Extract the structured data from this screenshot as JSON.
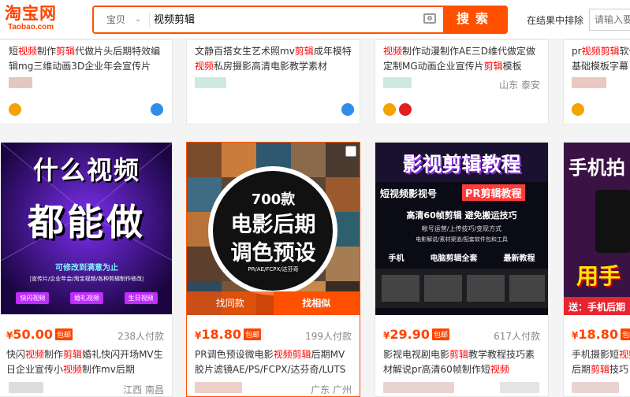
{
  "header": {
    "logo_cn": "淘宝网",
    "logo_en": "Taobao.com",
    "scope": "宝贝",
    "query": "视频剪辑",
    "search_button": "搜索",
    "exclude_label": "在结果中排除",
    "exclude_placeholder": "请输入要"
  },
  "top_row": [
    {
      "l1a": "短",
      "l1k": "视频",
      "l1b": "制作",
      "l1k2": "剪辑",
      "l1c": "代做片头后期特效编",
      "l2": "辑mg三维动画3D企业年会宣传片",
      "loc": ""
    },
    {
      "l1a": "文静百搭女生艺术照mv",
      "l1k": "剪辑",
      "l1b": "成年模特",
      "l2k": "视频",
      "l2": "私房摄影高清电影教学素材",
      "loc": ""
    },
    {
      "l1k": "视频",
      "l1b": "制作动漫制作AE三D维代做定做",
      "l2a": "定制MG动画企业宣传片",
      "l2k": "剪辑",
      "l2b": "模板",
      "loc": "山东 泰安"
    },
    {
      "l1a": "pr",
      "l1k": "视频剪辑",
      "l1b": "软件",
      "l2": "基础模板字幕",
      "loc": ""
    }
  ],
  "products": [
    {
      "banner_l1": "什么视频",
      "banner_l2": "都能做",
      "banner_sub": "可修改到满意为止",
      "banner_tags": "|宣传片/企业年会/淘宝视频/各种剪辑制作修改|",
      "banner_pill1": "快闪视频",
      "banner_pill2": "婚礼视频",
      "banner_pill3": "生日视频",
      "price": "50.00",
      "badge": "包邮",
      "sold": "238人付款",
      "t1a": "快闪",
      "t1k": "视频",
      "t1b": "制作",
      "t1k2": "剪辑",
      "t1c": "婚礼快闪开场MV生",
      "t2a": "日企业宣传小",
      "t2k": "视频",
      "t2b": "制作mv后期",
      "loc": "江西 南昌"
    },
    {
      "circle_num": "700款",
      "circle_l1": "电影后期",
      "circle_l2": "调色预设",
      "circle_small": "PR/AE/FCPX/达芬奇",
      "btn_same": "找同款",
      "btn_similar": "找相似",
      "price": "18.80",
      "badge": "包邮",
      "sold": "199人付款",
      "t1a": "PR调色预设微电影",
      "t1k": "视频剪辑",
      "t1b": "后期MV",
      "t2": "胶片滤镜AE/PS/FCPX/达芬奇/LUTS",
      "loc": "广东 广州"
    },
    {
      "banner_title": "影视剪辑教程",
      "banner_l2a": "短视频影视号",
      "banner_l2b": "PR剪辑教程",
      "banner_l3": "高清60帧剪辑  避免搬运技巧",
      "banner_l4": "帐号运营/上传技巧/变现方式",
      "banner_l5": "电影解说/素材渠道/配套软件包和工具",
      "banner_l6a": "手机",
      "banner_l6b": "电脑剪辑全套",
      "banner_l6c": "最新教程",
      "price": "29.90",
      "badge": "包邮",
      "sold": "617人付款",
      "t1a": "影视电视剧电影",
      "t1k": "剪辑",
      "t1b": "教学教程技巧素",
      "t2a": "材解说pr高清60帧制作短",
      "t2k": "视频",
      "loc": ""
    },
    {
      "banner_title": "手机拍",
      "banner_mid": "用手",
      "banner_send": "送：手机后期",
      "price": "18.80",
      "badge": "包邮",
      "t1": "手机摄影短",
      "t1k": "视频",
      "t2a": "后期",
      "t2k": "剪辑",
      "t2b": "技巧",
      "loc": ""
    }
  ],
  "colors": {
    "accent": "#ff5000",
    "price": "#ff4400",
    "keyword": "#ff0000"
  }
}
